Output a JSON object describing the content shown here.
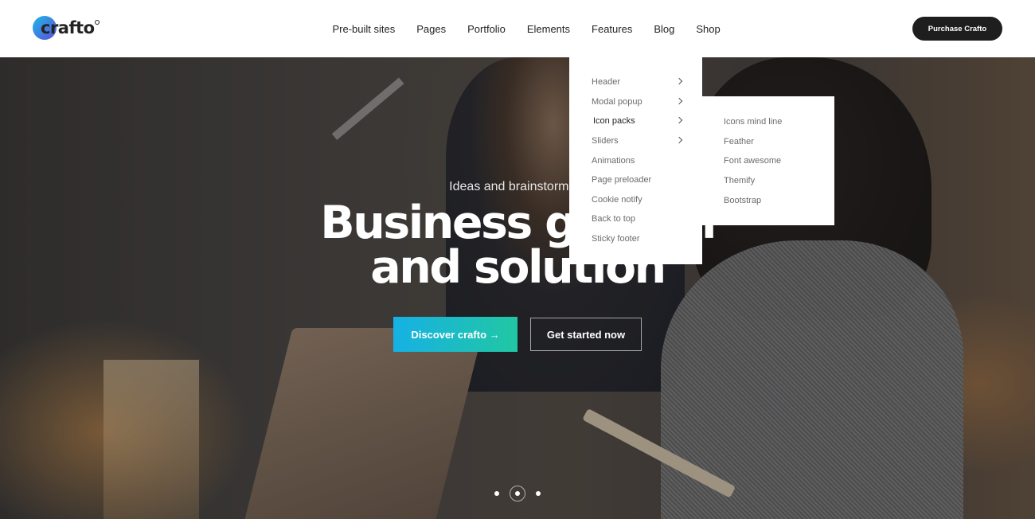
{
  "brand": {
    "logo_text": "crafto"
  },
  "nav": {
    "items": [
      "Pre-built sites",
      "Pages",
      "Portfolio",
      "Elements",
      "Features",
      "Blog",
      "Shop"
    ]
  },
  "header": {
    "purchase_label": "Purchase Crafto"
  },
  "hero": {
    "subtitle": "Ideas and brainstorming",
    "title_line1": "Business growth",
    "title_line2": "and solution",
    "discover_label": "Discover crafto →",
    "started_label": "Get started now"
  },
  "features_menu": {
    "items": [
      {
        "label": "Header",
        "has_submenu": true
      },
      {
        "label": "Modal popup",
        "has_submenu": true
      },
      {
        "label": "Icon packs",
        "has_submenu": true,
        "active": true
      },
      {
        "label": "Sliders",
        "has_submenu": true
      },
      {
        "label": "Animations",
        "has_submenu": false
      },
      {
        "label": "Page preloader",
        "has_submenu": false
      },
      {
        "label": "Cookie notify",
        "has_submenu": false
      },
      {
        "label": "Back to top",
        "has_submenu": false
      },
      {
        "label": "Sticky footer",
        "has_submenu": false
      }
    ]
  },
  "icon_packs_menu": {
    "items": [
      "Icons mind line",
      "Feather",
      "Font awesome",
      "Themify",
      "Bootstrap"
    ]
  },
  "slider": {
    "slide_count": 3,
    "active_index": 1
  },
  "colors": {
    "accent_start": "#16b1e4",
    "accent_end": "#21c7a3",
    "dark_button": "#1e1e1e"
  }
}
